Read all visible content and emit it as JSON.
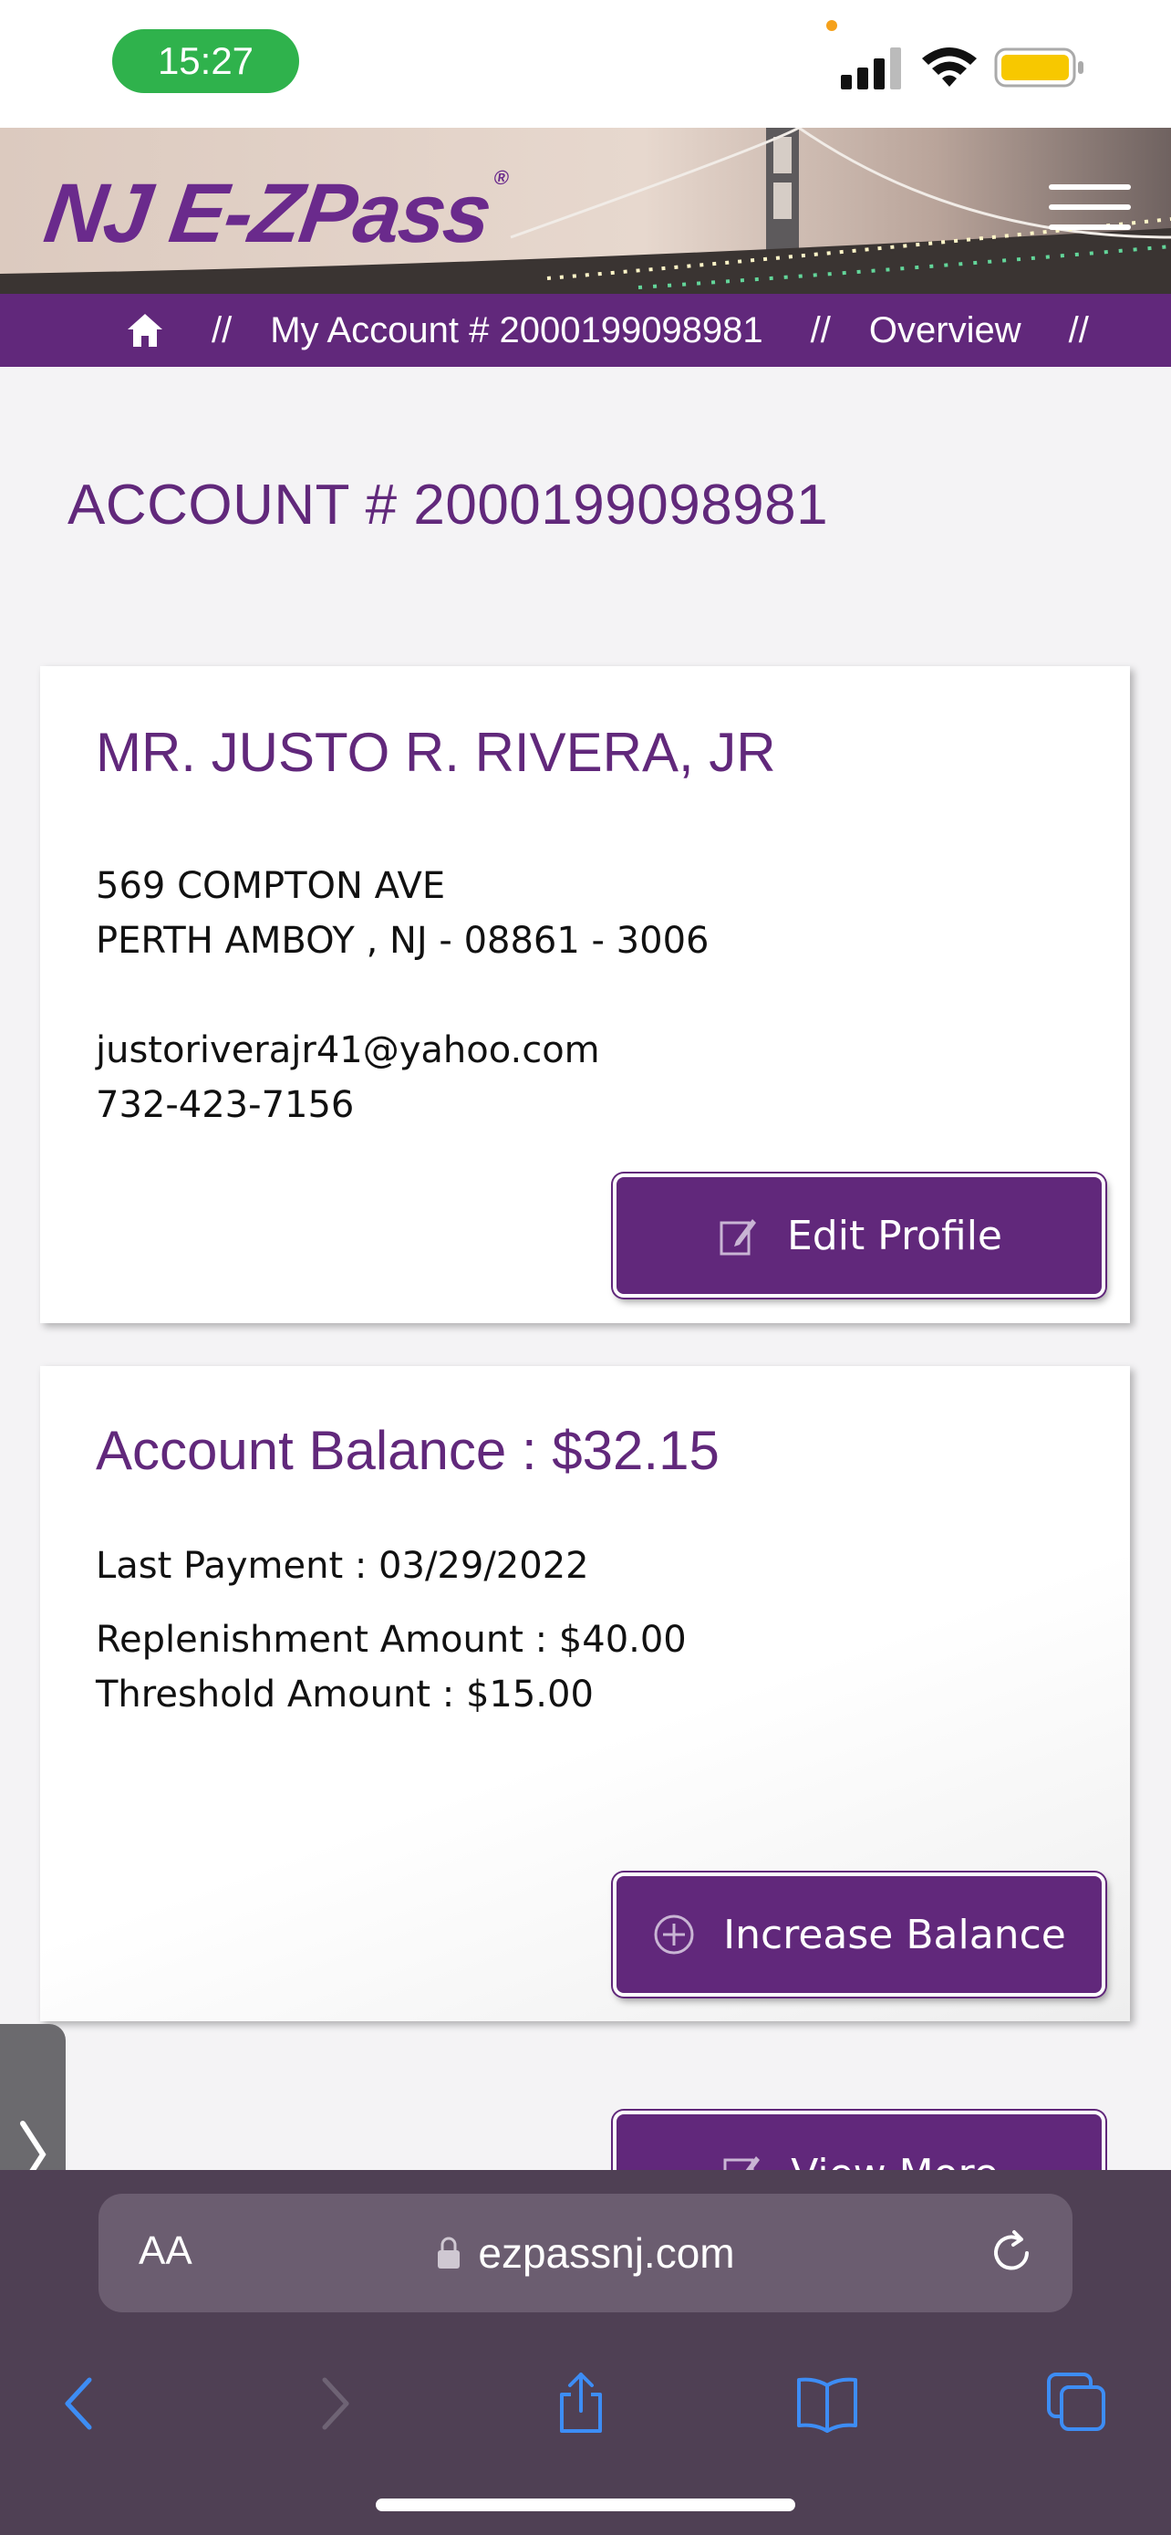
{
  "status_bar": {
    "time": "15:27"
  },
  "header": {
    "logo_text": "NJ E-ZPass",
    "logo_mark": "®"
  },
  "breadcrumb": {
    "separator": "//",
    "items": [
      "My Account # 2000199098981",
      "Overview"
    ]
  },
  "account": {
    "title": "ACCOUNT # 2000199098981"
  },
  "profile": {
    "name": "MR. JUSTO R. RIVERA, JR",
    "address_line1": "569 COMPTON AVE",
    "address_line2": "PERTH AMBOY , NJ - 08861 - 3006",
    "email": "justoriverajr41@yahoo.com",
    "phone": "732-423-7156",
    "edit_button": "Edit Profile"
  },
  "balance": {
    "title": "Account Balance : $32.15",
    "last_payment": "Last Payment : 03/29/2022",
    "replenishment": "Replenishment Amount : $40.00",
    "threshold": "Threshold Amount : $15.00",
    "increase_button": "Increase Balance"
  },
  "partial": {
    "view_more_button": "View More"
  },
  "safari": {
    "text_size_label": "AA",
    "url": "ezpassnj.com"
  },
  "colors": {
    "brand_purple": "#61287b",
    "status_green": "#2fb24c",
    "toolbar_bg": "#4f4054",
    "nav_icon_blue": "#3d8df5"
  },
  "icons": [
    "home-icon",
    "edit-icon",
    "plus-circle-icon",
    "lock-icon",
    "reload-icon",
    "back-icon",
    "forward-icon",
    "share-icon",
    "bookmarks-icon",
    "tabs-icon",
    "chevron-right-icon",
    "hamburger-menu-icon",
    "signal-icon",
    "wifi-icon",
    "battery-icon"
  ]
}
